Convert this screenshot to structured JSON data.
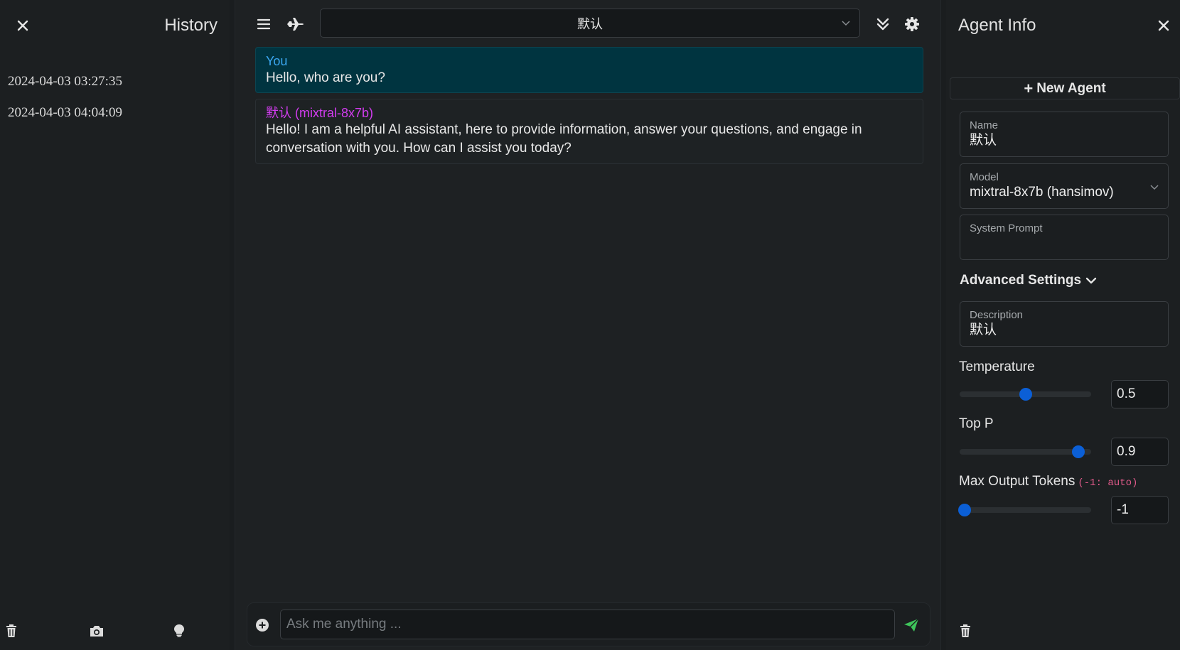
{
  "history": {
    "title": "History",
    "items": [
      "2024-04-03 03:27:35",
      "2024-04-03 04:04:09"
    ]
  },
  "toolbar": {
    "agent_selected": "默认"
  },
  "messages": [
    {
      "sender": "You",
      "text": "Hello, who are you?"
    },
    {
      "sender": "默认 (mixtral-8x7b)",
      "text": "Hello! I am a helpful AI assistant, here to provide information, answer your questions, and engage in conversation with you. How can I assist you today?"
    }
  ],
  "input": {
    "placeholder": "Ask me anything ..."
  },
  "agent_info": {
    "title": "Agent Info",
    "new_agent_label": "New Agent",
    "name_label": "Name",
    "name_value": "默认",
    "model_label": "Model",
    "model_value": "mixtral-8x7b (hansimov)",
    "system_prompt_label": "System Prompt",
    "system_prompt_value": "",
    "advanced_label": "Advanced Settings",
    "description_label": "Description",
    "description_value": "默认",
    "temperature_label": "Temperature",
    "temperature_value": "0.5",
    "temperature_fraction": 0.5,
    "top_p_label": "Top P",
    "top_p_value": "0.9",
    "top_p_fraction": 0.9,
    "max_tokens_label": "Max Output Tokens",
    "max_tokens_hint": "(-1: auto)",
    "max_tokens_value": "-1",
    "max_tokens_fraction": 0.04
  },
  "colors": {
    "background": "#1c1f21",
    "user_bubble": "#003440",
    "user_name": "#3ba7f0",
    "bot_name": "#d33cf0",
    "slider_thumb": "#0b5fd6",
    "send_icon": "#3ec45a"
  },
  "icons": {
    "history_close": "close-icon",
    "footer": [
      "trash-icon",
      "camera-icon",
      "lightbulb-icon"
    ],
    "menu": "menu-icon",
    "plane": "airplane-icon",
    "collapse": "double-chevron-down-icon",
    "settings": "gear-icon",
    "add": "plus-circle-icon",
    "send": "send-icon",
    "agent_close": "close-icon",
    "agent_trash": "trash-icon"
  }
}
